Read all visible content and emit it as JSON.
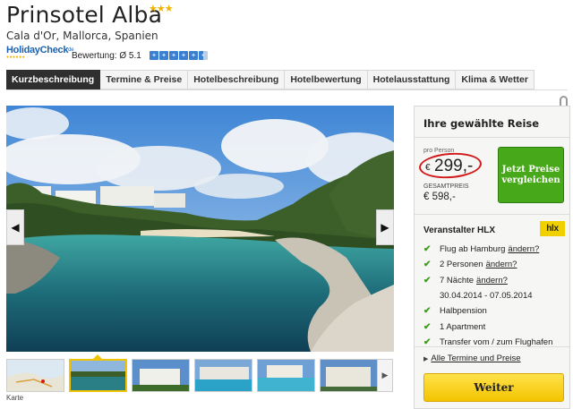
{
  "hotel": {
    "name": "Prinsotel Alba",
    "stars": "★★★",
    "location": "Cala d'Or, Mallorca, Spanien"
  },
  "reviews": {
    "logo_text": "HolidayCheck",
    "logo_suffix": "de",
    "rating_label": "Bewertung: Ø 5.1",
    "rating_value": 5.1,
    "rating_max": 6
  },
  "tabs": [
    {
      "label": "Kurzbeschreibung",
      "active": true
    },
    {
      "label": "Termine & Preise",
      "active": false
    },
    {
      "label": "Hotelbeschreibung",
      "active": false
    },
    {
      "label": "Hotelbewertung",
      "active": false
    },
    {
      "label": "Hotelausstattung",
      "active": false
    },
    {
      "label": "Klima & Wetter",
      "active": false
    }
  ],
  "gallery": {
    "prev_icon": "chevron-left-icon",
    "next_icon": "chevron-right-icon",
    "map_caption": "Karte",
    "thumbnail_count": 6,
    "active_thumbnail": 1
  },
  "booking": {
    "title": "Ihre gewählte Reise",
    "per_person_label": "pro Person",
    "currency": "€",
    "price": "299,-",
    "total_label": "GESAMTPREIS",
    "total_value": "€ 598,-",
    "compare_button": "Jetzt Preise vergleichen",
    "operator_label": "Veranstalter HLX",
    "operator_logo": "hlx",
    "features": [
      {
        "text": "Flug ab Hamburg",
        "link": "ändern?"
      },
      {
        "text": "2 Personen",
        "link": "ändern?"
      },
      {
        "text": "7 Nächte",
        "link": "ändern?"
      },
      {
        "text": "30.04.2014 - 07.05.2014",
        "link": null,
        "sub": true
      },
      {
        "text": "Halbpension",
        "link": null
      },
      {
        "text": "1 Apartment",
        "link": null
      },
      {
        "text": "Transfer vom / zum Flughafen",
        "link": null
      }
    ],
    "all_dates_link": "Alle Termine und Preise",
    "continue_button": "Weiter"
  },
  "colors": {
    "accent_green": "#47a81a",
    "accent_yellow": "#f3c400",
    "price_circle": "#d21a1a",
    "tab_active": "#2f2f2f"
  }
}
